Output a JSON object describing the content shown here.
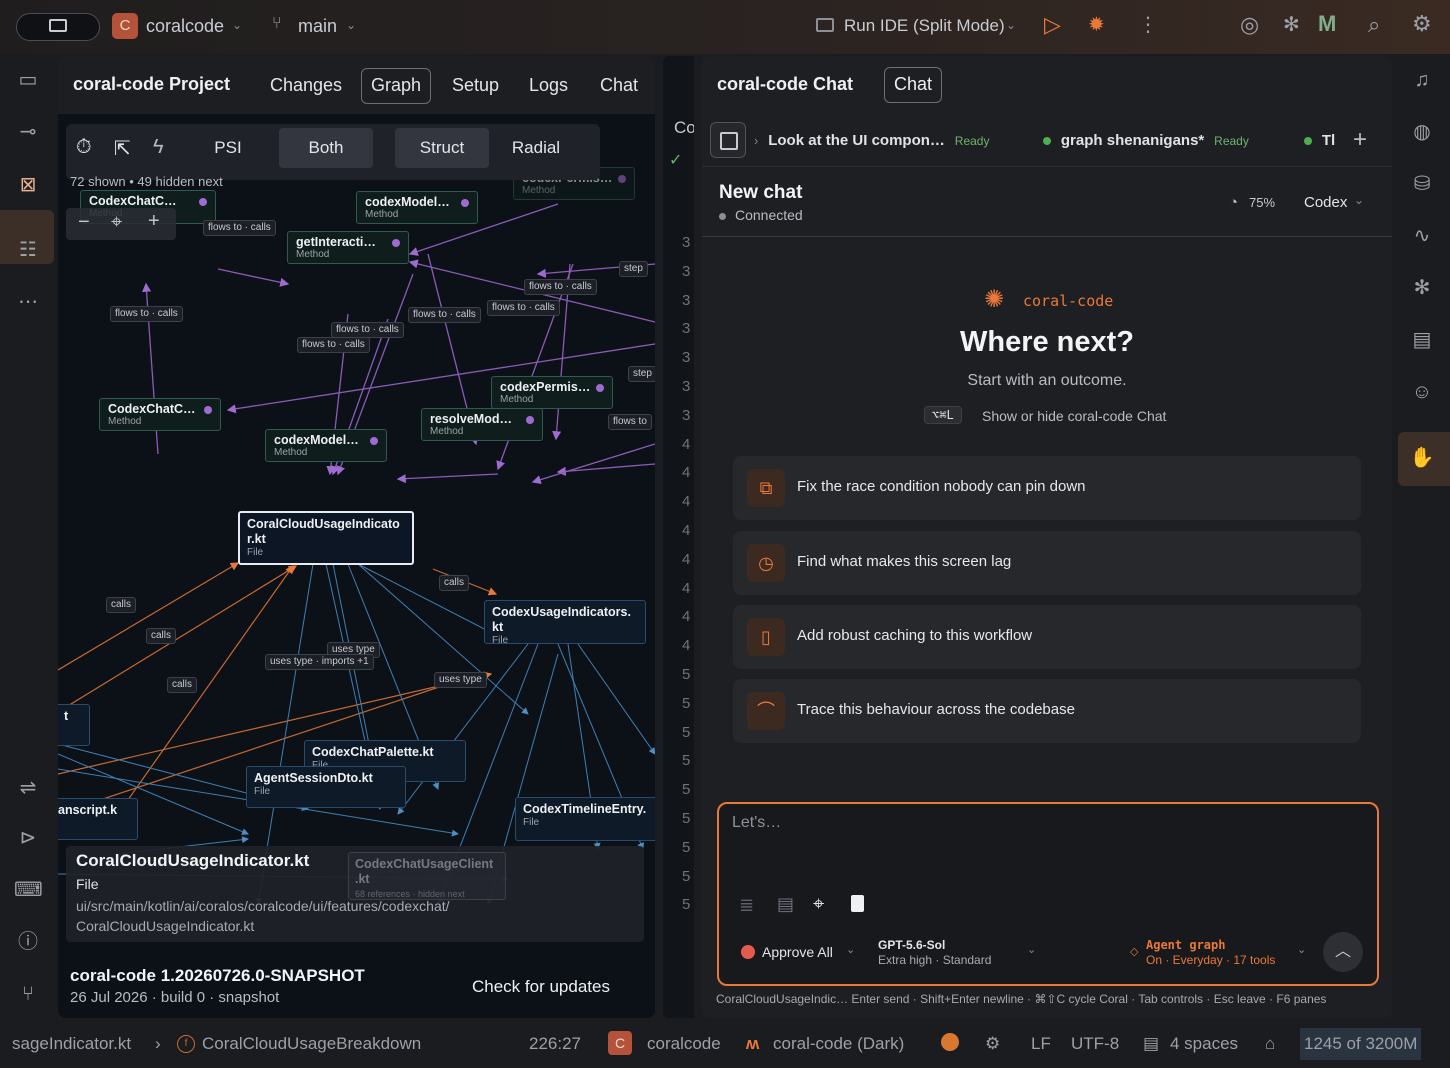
{
  "titlebar": {
    "project_badge": "C",
    "project_name": "coralcode",
    "branch": "main",
    "run_config": "Run IDE (Split Mode)"
  },
  "project_panel": {
    "title": "coral-code Project",
    "tabs": [
      "Changes",
      "Graph",
      "Setup",
      "Logs",
      "Chat"
    ],
    "selected_tab": "Graph",
    "graph_tools": {
      "psi": "PSI",
      "both": "Both",
      "struct": "Struct",
      "radial": "Radial"
    },
    "status": "72 shown • 49 hidden next",
    "nodes": {
      "n1": {
        "title": "CodexChatC…",
        "kind": "Method"
      },
      "n2": {
        "title": "codexModel…",
        "kind": "Method"
      },
      "n3": {
        "title": "getInteracti…",
        "kind": "Method"
      },
      "n4": {
        "title": "codexPermis…",
        "kind": "Method"
      },
      "n5": {
        "title": "CodexChatC…",
        "kind": "Method"
      },
      "n6": {
        "title": "codexPermis…",
        "kind": "Method"
      },
      "n7": {
        "title": "resolveMod…",
        "kind": "Method"
      },
      "n8": {
        "title": "codexModel…",
        "kind": "Method"
      },
      "f1": {
        "title": "CoralCloudUsageIndicato r.kt",
        "kind": "File"
      },
      "f2": {
        "title": "CodexUsageIndicators. kt",
        "kind": "File"
      },
      "f3": {
        "title": "CodexChatPalette.kt",
        "kind": "File"
      },
      "f4": {
        "title": "AgentSessionDto.kt",
        "kind": "File"
      },
      "f5": {
        "title": "anscript.k",
        "kind": ""
      },
      "f6": {
        "title": "CodexTimelineEntry.",
        "kind": "File"
      },
      "f7": {
        "title": "t",
        "kind": ""
      }
    },
    "edge_labels": {
      "flows_calls": "flows to · calls",
      "step": "step",
      "flows_to": "flows to",
      "calls": "calls",
      "uses_type": "uses type",
      "uses_type_imports": "uses type · imports +1"
    },
    "selected": {
      "name": "CoralCloudUsageIndicator.kt",
      "kind": "File",
      "path_line1": "ui/src/main/kotlin/ai/coralos/coralcode/ui/features/codexchat/",
      "path_line2": "CoralCloudUsageIndicator.kt"
    },
    "ghost_node": {
      "title": "CodexChatUsageClient .kt",
      "sub": "68 references · hidden next"
    },
    "footer": {
      "version": "coral-code 1.20260726.0-SNAPSHOT",
      "build": "26 Jul 2026 · build 0 · snapshot",
      "update_button": "Check for updates"
    }
  },
  "editor_strip": {
    "tab_label": "Co",
    "line_numbers": [
      "3",
      "3",
      "3",
      "3",
      "3",
      "3",
      "3",
      "4",
      "4",
      "4",
      "4",
      "4",
      "4",
      "4",
      "4",
      "5",
      "5",
      "5",
      "5",
      "5",
      "5",
      "5",
      "5",
      "5"
    ]
  },
  "chat_panel": {
    "title": "coral-code Chat",
    "tab": "Chat",
    "sessions": [
      {
        "title": "Look at the UI compon…",
        "status": "Ready"
      },
      {
        "title": "graph shenanigans*",
        "status": "Ready"
      },
      {
        "title": "Tl",
        "status": ""
      }
    ],
    "new_chat": {
      "title": "New chat",
      "status": "Connected",
      "usage": "75%",
      "model_select": "Codex"
    },
    "brand": "coral-code",
    "headline": "Where next?",
    "subhead": "Start with an outcome.",
    "shortcut_key": "⌥⌘L",
    "shortcut_text": "Show or hide coral-code Chat",
    "suggestions": [
      "Fix the race condition nobody can pin down",
      "Find what makes this screen lag",
      "Add robust caching to this workflow",
      "Trace this behaviour across the codebase"
    ],
    "composer": {
      "placeholder": "Let's…",
      "approve": "Approve All",
      "model": "GPT-5.6-Sol",
      "model_sub": "Extra high · Standard",
      "agent": "Agent graph",
      "agent_sub": "On · Everyday · 17 tools"
    },
    "hints": "CoralCloudUsageIndic… Enter send · Shift+Enter newline · ⌘⇧C cycle Coral · Tab controls · Esc leave · F6 panes"
  },
  "statusbar": {
    "file_crumb": "sageIndicator.kt",
    "symbol": "CoralCloudUsageBreakdown",
    "position": "226:27",
    "project_badge": "C",
    "project": "coralcode",
    "theme": "coral-code (Dark)",
    "line_sep": "LF",
    "encoding": "UTF-8",
    "indent": "4 spaces",
    "memory": "1245 of 3200M"
  },
  "colors": {
    "accent": "#e8793a",
    "method_dot": "#a06bd1",
    "ready": "#4caf50"
  }
}
